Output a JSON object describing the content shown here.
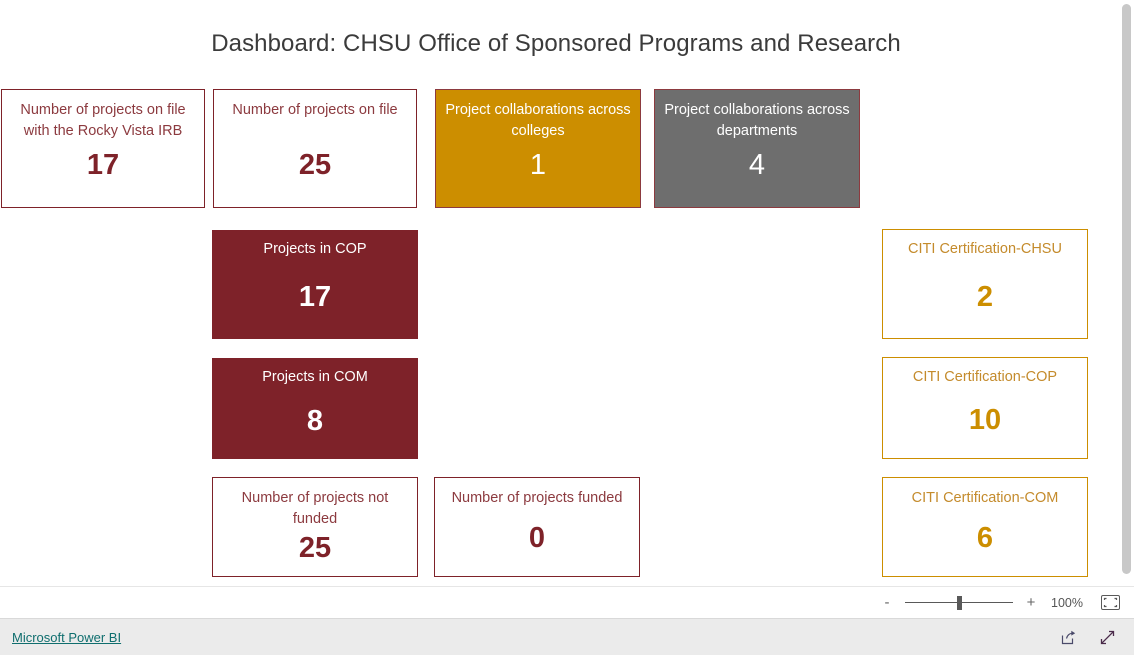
{
  "report": {
    "title": "Dashboard: CHSU Office of Sponsored Programs and Research",
    "colors": {
      "maroon": "#7E2229",
      "gold": "#CC8E00",
      "gray": "#6E6E6E",
      "title_ink": "#3B3B3B",
      "link_teal": "#0F6E6E"
    },
    "cards": [
      {
        "id": "projects-rocky-vista-irb",
        "label": "Number of projects on file with the Rocky Vista IRB",
        "value": "17",
        "style": "white-maroon"
      },
      {
        "id": "projects-on-file",
        "label": "Number of projects on file",
        "value": "25",
        "style": "white-maroon"
      },
      {
        "id": "collaborations-colleges",
        "label": "Project collaborations across colleges",
        "value": "1",
        "style": "gold"
      },
      {
        "id": "collaborations-departments",
        "label": "Project collaborations across departments",
        "value": "4",
        "style": "gray"
      },
      {
        "id": "projects-in-cop",
        "label": "Projects in COP",
        "value": "17",
        "style": "maroon"
      },
      {
        "id": "projects-in-com",
        "label": "Projects in COM",
        "value": "8",
        "style": "maroon"
      },
      {
        "id": "projects-not-funded",
        "label": "Number of projects not funded",
        "value": "25",
        "style": "white-maroon"
      },
      {
        "id": "projects-funded",
        "label": "Number of projects funded",
        "value": "0",
        "style": "white-maroon"
      },
      {
        "id": "citi-certification-chsu",
        "label": "CITI Certification-CHSU",
        "value": "2",
        "style": "white-gold"
      },
      {
        "id": "citi-certification-cop",
        "label": "CITI Certification-COP",
        "value": "10",
        "style": "white-gold"
      },
      {
        "id": "citi-certification-com",
        "label": "CITI Certification-COM",
        "value": "6",
        "style": "white-gold"
      }
    ]
  },
  "zoombar": {
    "minus_label": "-",
    "plus_label": "+",
    "zoom_level": "100%",
    "fit_icon": "fit-to-page-icon"
  },
  "footer": {
    "brand_link": "Microsoft Power BI",
    "share_icon": "share-icon",
    "fullscreen_icon": "fullscreen-icon"
  }
}
